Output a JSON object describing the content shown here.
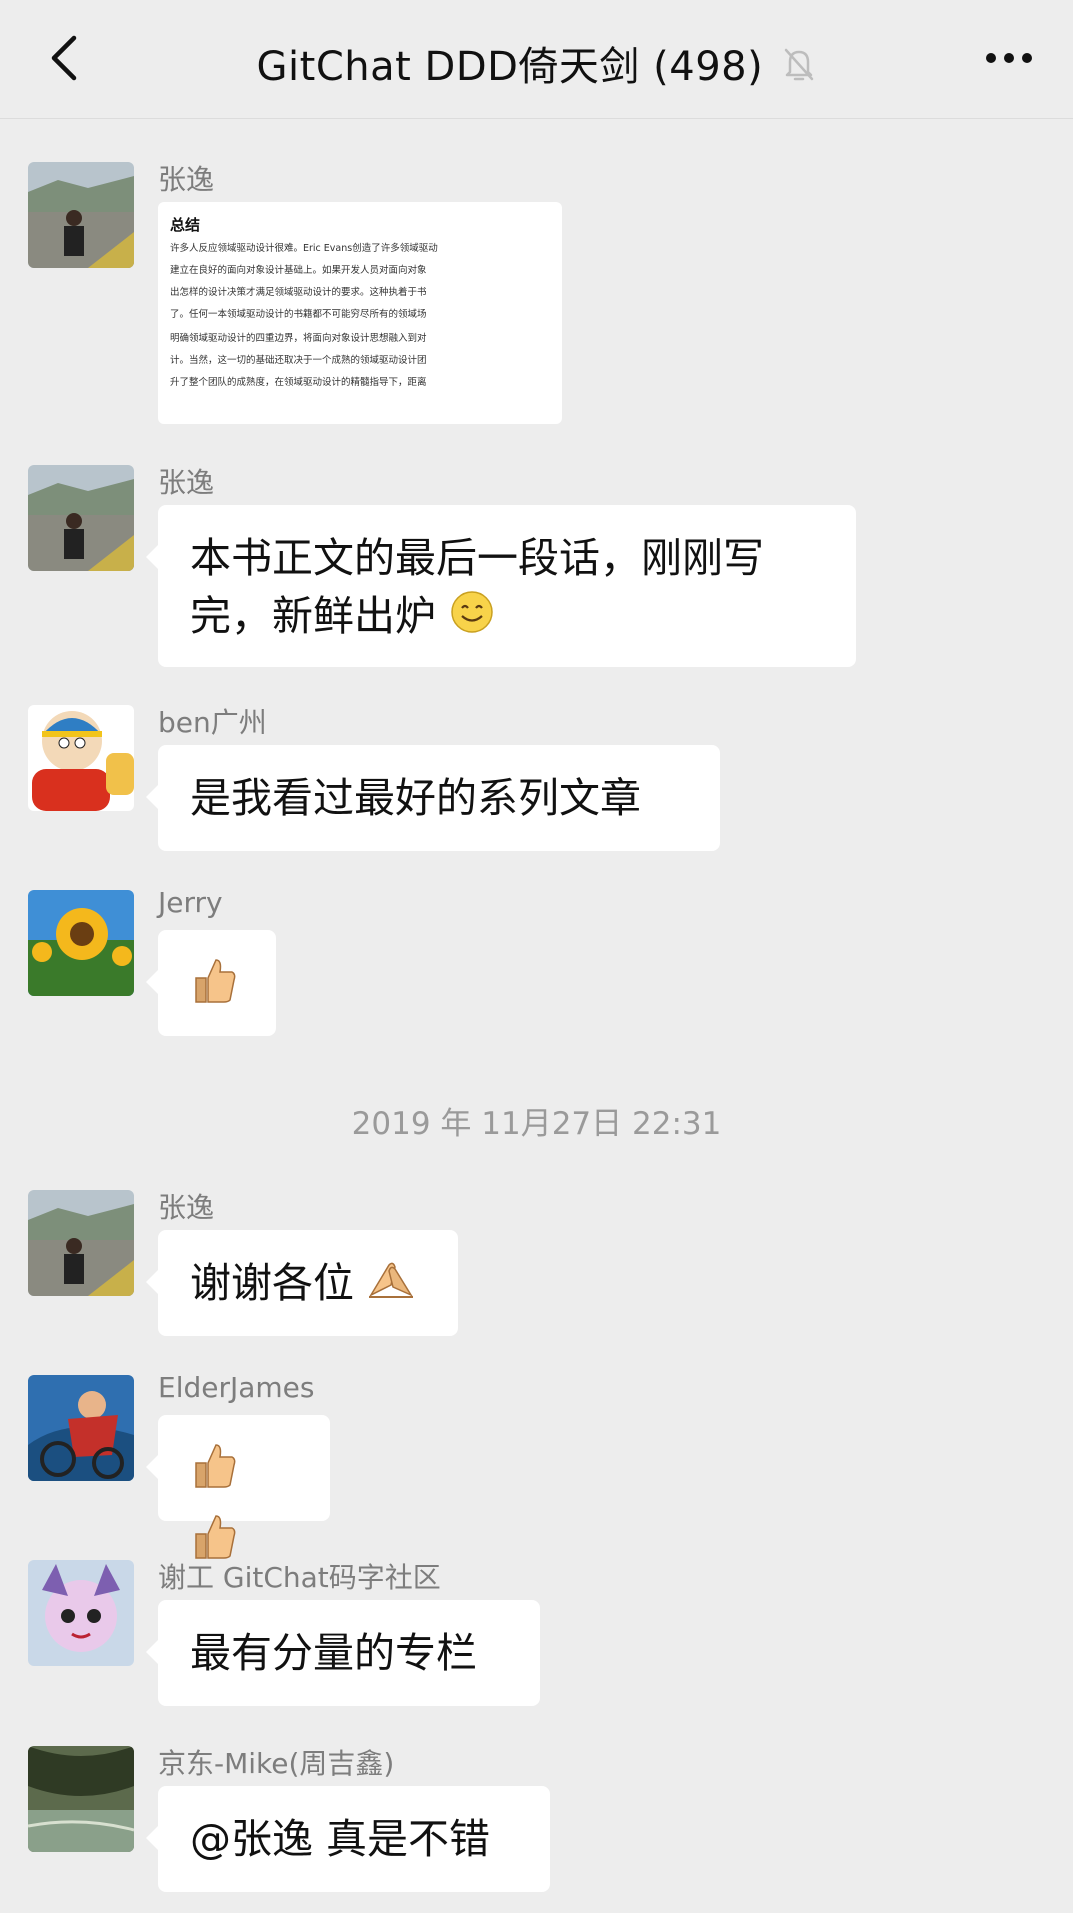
{
  "header": {
    "title": "GitChat DDD倚天剑 (498)",
    "back_icon": "chevron-left-icon",
    "mute_icon": "bell-muted-icon",
    "more_icon": "ellipsis-icon"
  },
  "messages": [
    {
      "sender": "张逸",
      "type": "image",
      "image": {
        "heading": "总结",
        "lines": [
          "许多人反应领域驱动设计很难。Eric Evans创造了许多领域驱动",
          "建立在良好的面向对象设计基础上。如果开发人员对面向对象",
          "出怎样的设计决策才满足领域驱动设计的要求。这种执着于书",
          "了。任何一本领域驱动设计的书籍都不可能穷尽所有的领域场",
          "明确领域驱动设计的四重边界，将面向对象设计思想融入到对",
          "计。当然，这一切的基础还取决于一个成熟的领域驱动设计团",
          "升了整个团队的成熟度，在领域驱动设计的精髓指导下，距离"
        ]
      }
    },
    {
      "sender": "张逸",
      "text_line1": "本书正文的最后一段话，刚刚写",
      "text_line2": "完，新鲜出炉",
      "emoji": "smile-emoji"
    },
    {
      "sender": "ben广州",
      "text": "是我看过最好的系列文章"
    },
    {
      "sender": "Jerry",
      "emoji": "thumbs-up-emoji"
    },
    {
      "sender": "张逸",
      "text": "谢谢各位",
      "emoji": "folded-hands-emoji"
    },
    {
      "sender": "ElderJames",
      "emoji": "thumbs-up-emoji x2"
    },
    {
      "sender": "谢工 GitChat码字社区",
      "text": "最有分量的专栏"
    },
    {
      "sender": "京东-Mike(周吉鑫)",
      "text": "@张逸 真是不错"
    }
  ],
  "timestamp": "2019 年 11月27日 22:31",
  "colors": {
    "background": "#ededed",
    "bubble": "#ffffff",
    "sender_name": "#7d7d7d",
    "timestamp": "#9a9a9a"
  }
}
